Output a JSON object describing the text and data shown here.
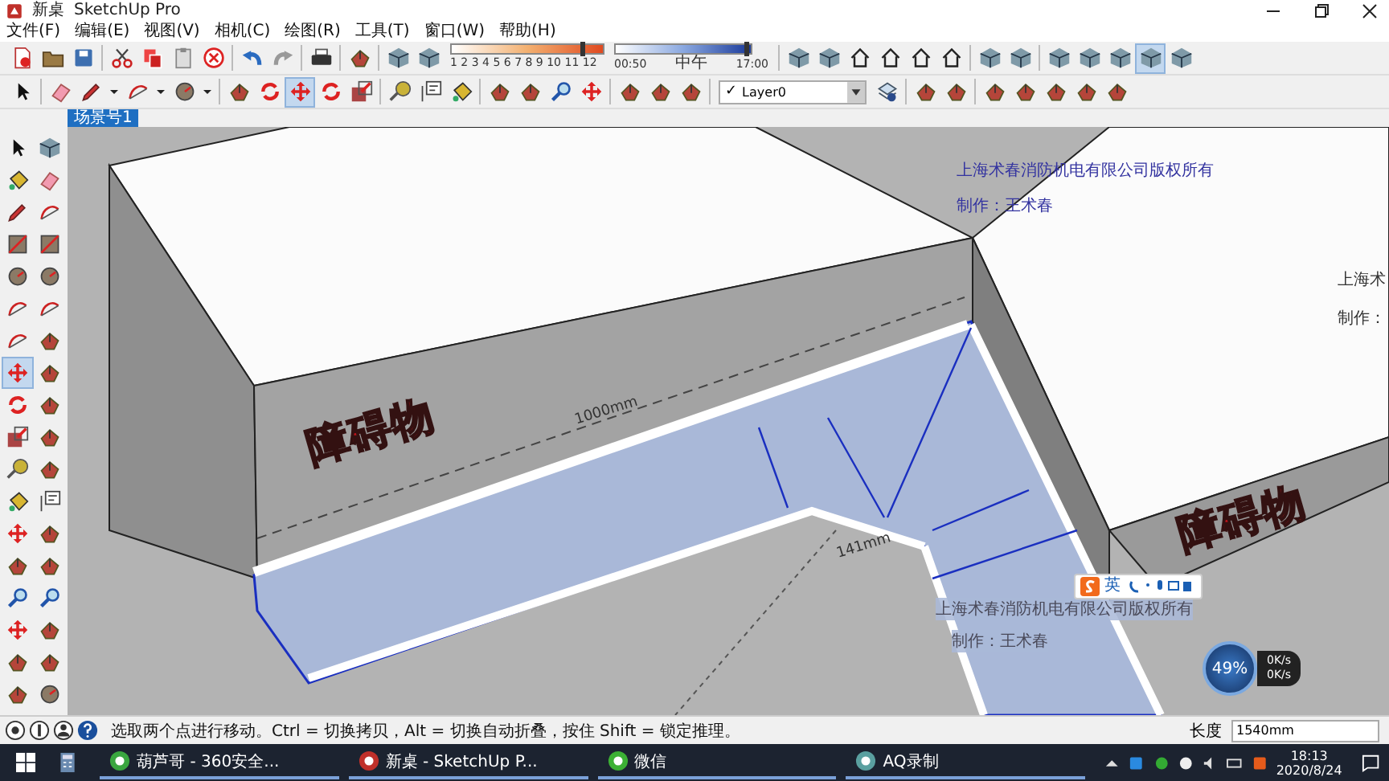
{
  "window": {
    "title": "新桌",
    "app": "SketchUp Pro"
  },
  "menu": [
    "文件(F)",
    "编辑(E)",
    "视图(V)",
    "相机(C)",
    "绘图(R)",
    "工具(T)",
    "窗口(W)",
    "帮助(H)"
  ],
  "toolbar_top": {
    "left": [
      {
        "kind": "document",
        "selected": false
      },
      {
        "kind": "folder",
        "selected": false
      },
      {
        "kind": "disk",
        "selected": false
      },
      {
        "kind": "separator"
      },
      {
        "kind": "scissors",
        "selected": false
      },
      {
        "kind": "copy",
        "selected": false
      },
      {
        "kind": "clipboard",
        "selected": false
      },
      {
        "kind": "xcircle",
        "selected": false
      },
      {
        "kind": "separator"
      },
      {
        "kind": "undo",
        "selected": false
      },
      {
        "kind": "redo",
        "selected": false
      },
      {
        "kind": "separator"
      },
      {
        "kind": "printer",
        "selected": false
      },
      {
        "kind": "separator"
      },
      {
        "kind": "blob",
        "selected": false
      },
      {
        "kind": "separator"
      },
      {
        "kind": "cube",
        "selected": false
      },
      {
        "kind": "cube",
        "selected": false
      }
    ],
    "right": [
      {
        "kind": "separator"
      },
      {
        "kind": "cube",
        "selected": false
      },
      {
        "kind": "cube",
        "selected": false
      },
      {
        "kind": "house",
        "selected": false
      },
      {
        "kind": "house",
        "selected": false
      },
      {
        "kind": "house",
        "selected": false
      },
      {
        "kind": "house",
        "selected": false
      },
      {
        "kind": "separator"
      },
      {
        "kind": "cube",
        "selected": false
      },
      {
        "kind": "cube",
        "selected": false
      },
      {
        "kind": "separator"
      },
      {
        "kind": "cube",
        "selected": false
      },
      {
        "kind": "cube",
        "selected": false
      },
      {
        "kind": "cube",
        "selected": false
      },
      {
        "kind": "cube",
        "selected": true
      },
      {
        "kind": "cube",
        "selected": false
      }
    ]
  },
  "shadow_panel": {
    "month_slider": {
      "level": 0.86
    },
    "time_slider": {
      "level": 0.96
    },
    "months": "1 2 3 4 5 6 7 8 9 10 11 12",
    "time_start": "00:50",
    "time_mid": "中午",
    "time_end": "17:00"
  },
  "toolbar_second": {
    "left": [
      {
        "kind": "cursor",
        "selected": false
      },
      {
        "kind": "separator"
      },
      {
        "kind": "eraser",
        "selected": false
      },
      {
        "kind": "pencil",
        "selected": false
      },
      {
        "kind": "caret",
        "selected": false
      },
      {
        "kind": "arc",
        "selected": false
      },
      {
        "kind": "caret",
        "selected": false
      },
      {
        "kind": "circle",
        "selected": false
      },
      {
        "kind": "caret",
        "selected": false
      },
      {
        "kind": "separator"
      },
      {
        "kind": "blob",
        "selected": false
      },
      {
        "kind": "rotate",
        "selected": false
      },
      {
        "kind": "move",
        "selected": true
      },
      {
        "kind": "rotate",
        "selected": false
      },
      {
        "kind": "scale",
        "selected": false
      },
      {
        "kind": "separator"
      },
      {
        "kind": "tape",
        "selected": false
      },
      {
        "kind": "label",
        "selected": false
      },
      {
        "kind": "bucket",
        "selected": false
      },
      {
        "kind": "separator"
      },
      {
        "kind": "blob",
        "selected": false
      },
      {
        "kind": "blob",
        "selected": false
      },
      {
        "kind": "magnifier",
        "selected": false
      },
      {
        "kind": "move",
        "selected": false
      },
      {
        "kind": "separator"
      },
      {
        "kind": "blob",
        "selected": false
      },
      {
        "kind": "blob",
        "selected": false
      },
      {
        "kind": "blob",
        "selected": false
      }
    ],
    "right": [
      {
        "kind": "layers",
        "selected": false
      },
      {
        "kind": "separator"
      },
      {
        "kind": "blob",
        "selected": false
      },
      {
        "kind": "blob",
        "selected": false
      },
      {
        "kind": "separator"
      },
      {
        "kind": "blob",
        "selected": false
      },
      {
        "kind": "blob",
        "selected": false
      },
      {
        "kind": "blob",
        "selected": false
      },
      {
        "kind": "blob",
        "selected": false
      },
      {
        "kind": "blob",
        "selected": false
      }
    ]
  },
  "layer": {
    "check": "✓",
    "value": "Layer0"
  },
  "scene_tabs": [
    {
      "label": "场景号1",
      "selected": true
    }
  ],
  "left_toolbar": [
    {
      "kind": "cursor",
      "selected": false
    },
    {
      "kind": "cube",
      "selected": false
    },
    {
      "kind": "bucket",
      "selected": false
    },
    {
      "kind": "eraser",
      "selected": false
    },
    {
      "kind": "pencil",
      "selected": false
    },
    {
      "kind": "arc",
      "selected": false
    },
    {
      "kind": "square",
      "selected": false
    },
    {
      "kind": "square",
      "selected": false
    },
    {
      "kind": "circle",
      "selected": false
    },
    {
      "kind": "circle",
      "selected": false
    },
    {
      "kind": "arc",
      "selected": false
    },
    {
      "kind": "arc",
      "selected": false
    },
    {
      "kind": "arc",
      "selected": false
    },
    {
      "kind": "blob",
      "selected": false
    },
    {
      "kind": "move",
      "selected": true
    },
    {
      "kind": "blob",
      "selected": false
    },
    {
      "kind": "rotate",
      "selected": false
    },
    {
      "kind": "blob",
      "selected": false
    },
    {
      "kind": "scale",
      "selected": false
    },
    {
      "kind": "blob",
      "selected": false
    },
    {
      "kind": "tape",
      "selected": false
    },
    {
      "kind": "blob",
      "selected": false
    },
    {
      "kind": "bucket",
      "selected": false
    },
    {
      "kind": "label",
      "selected": false
    },
    {
      "kind": "move",
      "selected": false
    },
    {
      "kind": "blob",
      "selected": false
    },
    {
      "kind": "blob",
      "selected": false
    },
    {
      "kind": "blob",
      "selected": false
    },
    {
      "kind": "magnifier",
      "selected": false
    },
    {
      "kind": "magnifier",
      "selected": false
    },
    {
      "kind": "move",
      "selected": false
    },
    {
      "kind": "blob",
      "selected": false
    },
    {
      "kind": "blob",
      "selected": false
    },
    {
      "kind": "blob",
      "selected": false
    },
    {
      "kind": "blob",
      "selected": false
    },
    {
      "kind": "circle",
      "selected": false
    }
  ],
  "canvas": {
    "labels": [
      {
        "kind": "watermark",
        "text": "上海术春消防机电有限公司版权所有"
      },
      {
        "kind": "watermark",
        "text": "制作：王术春"
      },
      {
        "kind": "watermark-cut",
        "text": "上海术"
      },
      {
        "kind": "watermark-cut",
        "text": "制作："
      },
      {
        "kind": "dimension",
        "text": "1000mm"
      },
      {
        "kind": "obstacle",
        "text": "障碍物"
      },
      {
        "kind": "dimension",
        "text": "141mm"
      },
      {
        "kind": "obstacle",
        "text": "障碍物"
      },
      {
        "kind": "watermark-grey",
        "text": "上海术春消防机电有限公司版权所有"
      },
      {
        "kind": "watermark-grey",
        "text": "制作：王术春"
      }
    ]
  },
  "ime_bar": {
    "label": "英"
  },
  "net_widget": {
    "percent": "49%",
    "upload": "0K/s",
    "download": "0K/s"
  },
  "status_bar": {
    "message": "选取两个点进行移动。Ctrl = 切换拷贝，Alt = 切换自动折叠，按住 Shift = 锁定推理。",
    "measure_label": "长度",
    "measure_value": "1540mm"
  },
  "taskbar": {
    "items": [
      {
        "kind": "browser",
        "label": "葫芦哥 - 360安全..."
      },
      {
        "kind": "sketchup",
        "label": "新桌 - SketchUp P..."
      },
      {
        "kind": "chat",
        "label": "微信"
      },
      {
        "kind": "recorder",
        "label": "AQ录制"
      }
    ],
    "time": "18:13",
    "date": "2020/8/24"
  }
}
